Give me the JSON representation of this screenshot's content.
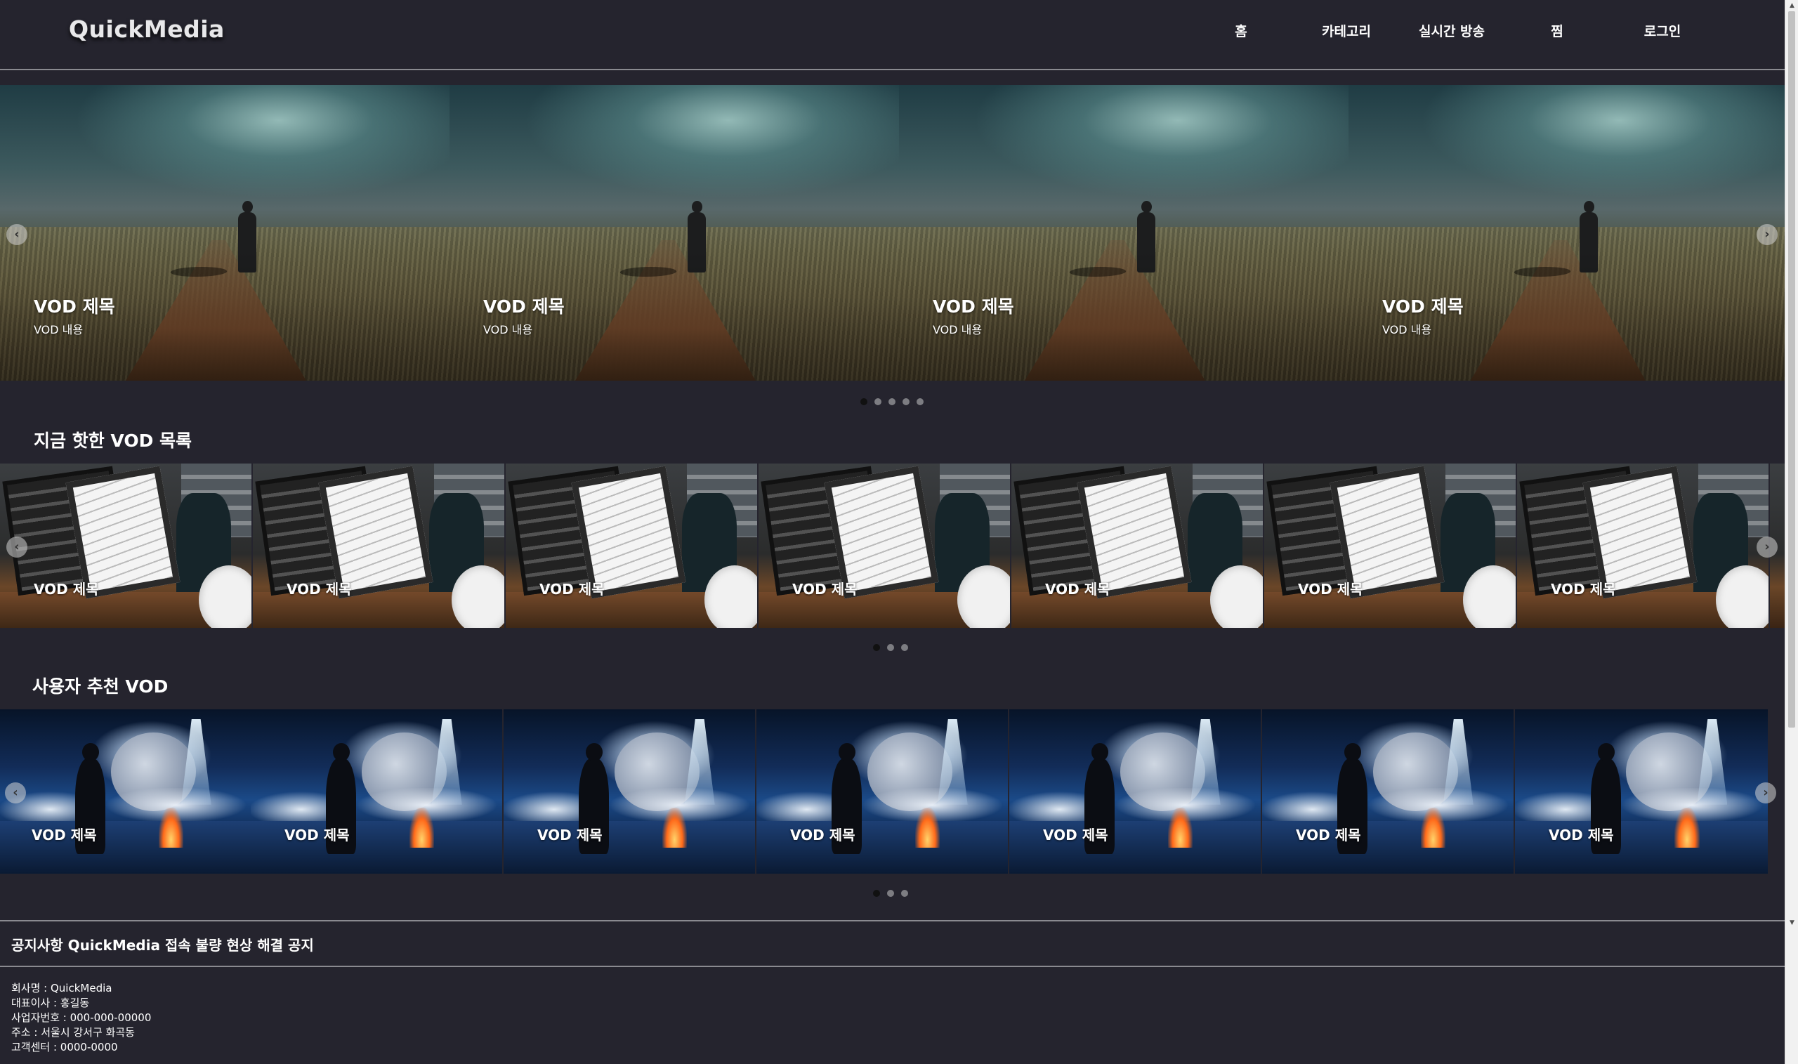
{
  "header": {
    "logo": "QuickMedia",
    "nav": [
      {
        "label": "홈"
      },
      {
        "label": "카테고리"
      },
      {
        "label": "실시간 방송"
      },
      {
        "label": "찜"
      },
      {
        "label": "로그인"
      }
    ]
  },
  "hero": {
    "slides": [
      {
        "title": "VOD 제목",
        "desc": "VOD 내용"
      },
      {
        "title": "VOD 제목",
        "desc": "VOD 내용"
      },
      {
        "title": "VOD 제목",
        "desc": "VOD 내용"
      },
      {
        "title": "VOD 제목",
        "desc": "VOD 내용"
      }
    ],
    "dot_count": 5,
    "active_dot": 1,
    "prev_icon": "chevron-left-icon",
    "next_icon": "chevron-right-icon"
  },
  "hot_vod": {
    "title": "지금 핫한 VOD 목록",
    "items": [
      {
        "title": "VOD 제목"
      },
      {
        "title": "VOD 제목"
      },
      {
        "title": "VOD 제목"
      },
      {
        "title": "VOD 제목"
      },
      {
        "title": "VOD 제목"
      },
      {
        "title": "VOD 제목"
      },
      {
        "title": "VOD 제목"
      }
    ],
    "dot_count": 3,
    "active_dot": 1
  },
  "recommended_vod": {
    "title": "사용자 추천 VOD",
    "items": [
      {
        "title": "VOD 제목"
      },
      {
        "title": "VOD 제목"
      },
      {
        "title": "VOD 제목"
      },
      {
        "title": "VOD 제목"
      },
      {
        "title": "VOD 제목"
      },
      {
        "title": "VOD 제목"
      },
      {
        "title": "VOD 제목"
      }
    ],
    "dot_count": 3,
    "active_dot": 1
  },
  "notice": {
    "text": "공지사항 QuickMedia 접속 불량 현상 해결 공지"
  },
  "company_info": {
    "name": "회사명 : QuickMedia",
    "ceo": "대표이사 : 홍길동",
    "business_number": "사업자번호 : 000-000-00000",
    "address": "주소 : 서울시 강서구 화곡동",
    "customer_center": "고객센터 : 0000-0000"
  },
  "colors": {
    "background": "#25242e",
    "divider": "#8a8a90",
    "dot_active": "#111111",
    "dot_inactive": "#7d7d82"
  }
}
